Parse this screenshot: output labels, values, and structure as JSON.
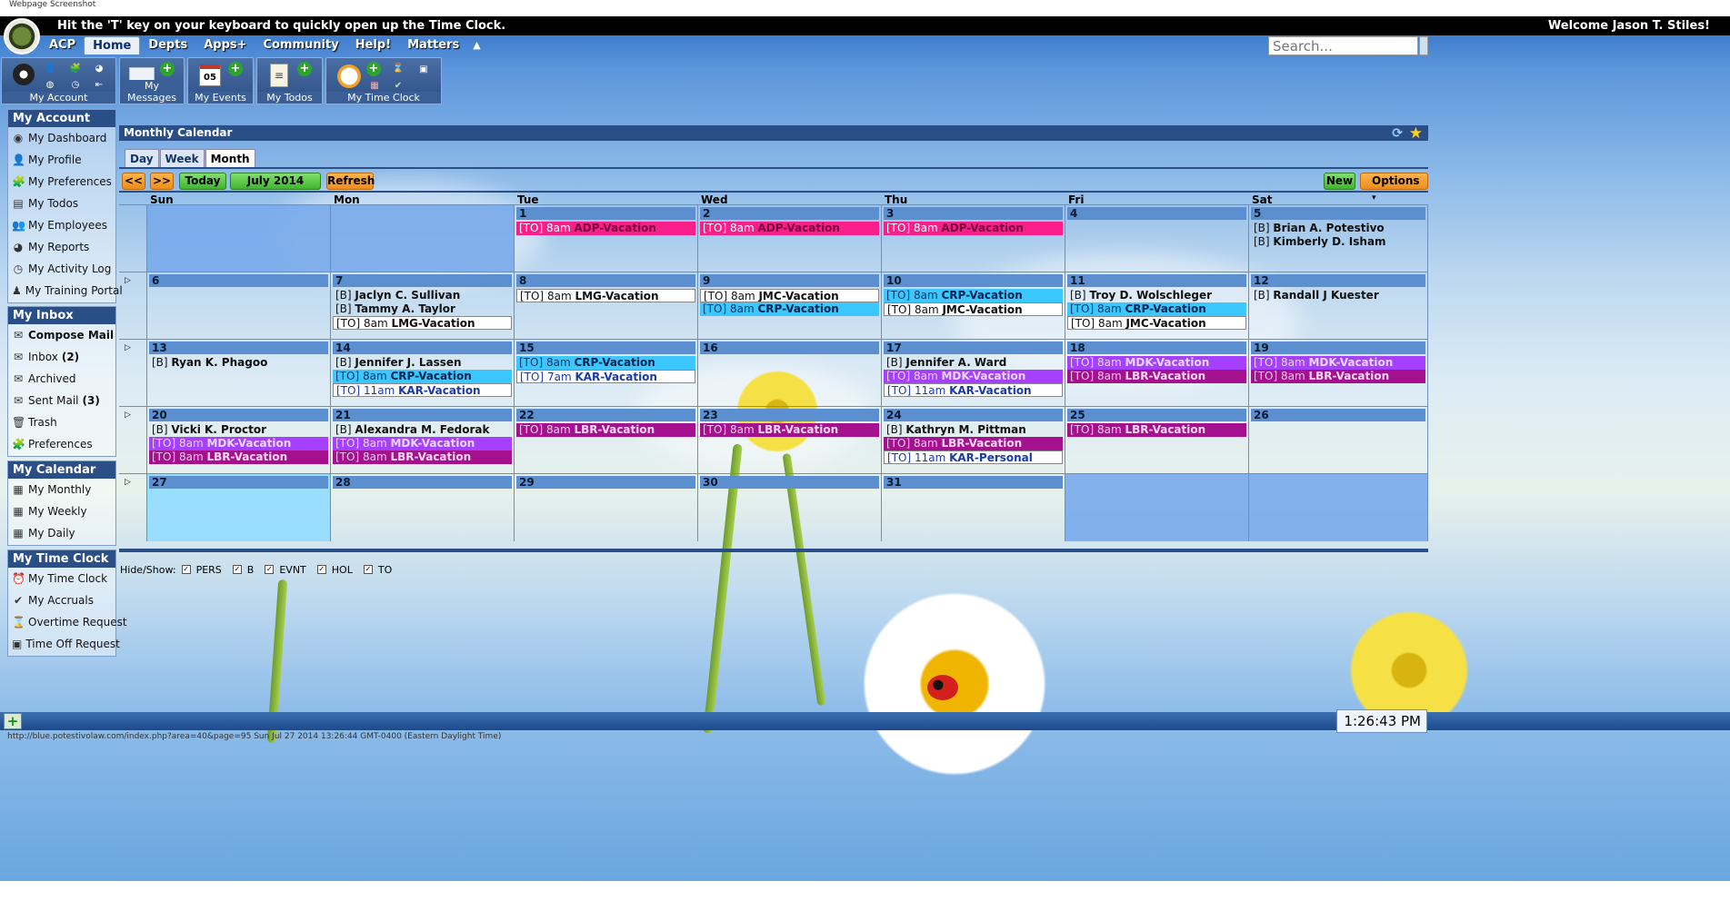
{
  "screenshot_label": "Webpage Screenshot",
  "notice": "Hit the 'T' key on your keyboard to quickly open up the Time Clock.",
  "welcome": "Welcome Jason T. Stiles!",
  "nav": [
    "ACP",
    "Home",
    "Depts",
    "Apps+",
    "Community",
    "Help!",
    "Matters"
  ],
  "nav_active": "Home",
  "search_placeholder": "Search...",
  "toolbar": {
    "my_account": "My Account",
    "my_messages": "My Messages",
    "my_events": "My Events",
    "my_todos": "My Todos",
    "my_time_clock": "My Time Clock",
    "events_day": "05"
  },
  "sidebar": {
    "account": {
      "title": "My Account",
      "items": [
        "My Dashboard",
        "My Profile",
        "My Preferences",
        "My Todos",
        "My Employees",
        "My Reports",
        "My Activity Log",
        "My Training Portal"
      ]
    },
    "inbox": {
      "title": "My Inbox",
      "items": [
        "Compose Mail",
        "Inbox",
        "Archived",
        "Sent Mail",
        "Trash",
        "Preferences"
      ],
      "inbox_count": "(2)",
      "sent_count": "(3)"
    },
    "calendar": {
      "title": "My Calendar",
      "items": [
        "My Monthly",
        "My Weekly",
        "My Daily"
      ]
    },
    "timeclock": {
      "title": "My Time Clock",
      "items": [
        "My Time Clock",
        "My Accruals",
        "Overtime Request",
        "Time Off Request"
      ]
    }
  },
  "calendar": {
    "title": "Monthly Calendar",
    "views": [
      "Day",
      "Week",
      "Month"
    ],
    "active_view": "Month",
    "buttons": {
      "prev": "<<",
      "next": ">>",
      "today": "Today",
      "month": "July 2014",
      "refresh": "Refresh",
      "new": "New",
      "options": "Options"
    },
    "weekdays": [
      "Sun",
      "Mon",
      "Tue",
      "Wed",
      "Thu",
      "Fri",
      "Sat"
    ],
    "weeks": [
      [
        {
          "day": "",
          "events": []
        },
        {
          "day": "",
          "events": []
        },
        {
          "day": "1",
          "events": [
            {
              "tag": "[TO]",
              "time": "8am",
              "name": "ADP-Vacation",
              "style": "pink"
            }
          ]
        },
        {
          "day": "2",
          "events": [
            {
              "tag": "[TO]",
              "time": "8am",
              "name": "ADP-Vacation",
              "style": "pink"
            }
          ]
        },
        {
          "day": "3",
          "events": [
            {
              "tag": "[TO]",
              "time": "8am",
              "name": "ADP-Vacation",
              "style": "pink"
            }
          ]
        },
        {
          "day": "4",
          "events": []
        },
        {
          "day": "5",
          "events": [
            {
              "tag": "[B]",
              "time": "",
              "name": "Brian A. Potestivo",
              "style": "b"
            },
            {
              "tag": "[B]",
              "time": "",
              "name": "Kimberly D. Isham",
              "style": "b"
            }
          ]
        }
      ],
      [
        {
          "day": "6",
          "events": []
        },
        {
          "day": "7",
          "events": [
            {
              "tag": "[B]",
              "time": "",
              "name": "Jaclyn C. Sullivan",
              "style": "b"
            },
            {
              "tag": "[B]",
              "time": "",
              "name": "Tammy A. Taylor",
              "style": "b"
            },
            {
              "tag": "[TO]",
              "time": "8am",
              "name": "LMG-Vacation",
              "style": "white"
            }
          ]
        },
        {
          "day": "8",
          "events": [
            {
              "tag": "[TO]",
              "time": "8am",
              "name": "LMG-Vacation",
              "style": "white"
            }
          ]
        },
        {
          "day": "9",
          "events": [
            {
              "tag": "[TO]",
              "time": "8am",
              "name": "JMC-Vacation",
              "style": "white"
            },
            {
              "tag": "[TO]",
              "time": "8am",
              "name": "CRP-Vacation",
              "style": "cyan"
            }
          ]
        },
        {
          "day": "10",
          "events": [
            {
              "tag": "[TO]",
              "time": "8am",
              "name": "CRP-Vacation",
              "style": "cyan"
            },
            {
              "tag": "[TO]",
              "time": "8am",
              "name": "JMC-Vacation",
              "style": "white"
            }
          ]
        },
        {
          "day": "11",
          "events": [
            {
              "tag": "[B]",
              "time": "",
              "name": "Troy D. Wolschleger",
              "style": "b"
            },
            {
              "tag": "[TO]",
              "time": "8am",
              "name": "CRP-Vacation",
              "style": "cyan"
            },
            {
              "tag": "[TO]",
              "time": "8am",
              "name": "JMC-Vacation",
              "style": "white"
            }
          ]
        },
        {
          "day": "12",
          "events": [
            {
              "tag": "[B]",
              "time": "",
              "name": "Randall J Kuester",
              "style": "b"
            }
          ]
        }
      ],
      [
        {
          "day": "13",
          "events": [
            {
              "tag": "[B]",
              "time": "",
              "name": "Ryan K. Phagoo",
              "style": "b"
            }
          ]
        },
        {
          "day": "14",
          "events": [
            {
              "tag": "[B]",
              "time": "",
              "name": "Jennifer J. Lassen",
              "style": "b"
            },
            {
              "tag": "[TO]",
              "time": "8am",
              "name": "CRP-Vacation",
              "style": "cyan"
            },
            {
              "tag": "[TO]",
              "time": "11am",
              "name": "KAR-Vacation",
              "style": "whiteblue"
            }
          ]
        },
        {
          "day": "15",
          "events": [
            {
              "tag": "[TO]",
              "time": "8am",
              "name": "CRP-Vacation",
              "style": "cyan"
            },
            {
              "tag": "[TO]",
              "time": "7am",
              "name": "KAR-Vacation",
              "style": "whiteblue"
            }
          ]
        },
        {
          "day": "16",
          "events": []
        },
        {
          "day": "17",
          "events": [
            {
              "tag": "[B]",
              "time": "",
              "name": "Jennifer A. Ward",
              "style": "b"
            },
            {
              "tag": "[TO]",
              "time": "8am",
              "name": "MDK-Vacation",
              "style": "purple"
            },
            {
              "tag": "[TO]",
              "time": "11am",
              "name": "KAR-Vacation",
              "style": "whiteblue"
            }
          ]
        },
        {
          "day": "18",
          "events": [
            {
              "tag": "[TO]",
              "time": "8am",
              "name": "MDK-Vacation",
              "style": "purple"
            },
            {
              "tag": "[TO]",
              "time": "8am",
              "name": "LBR-Vacation",
              "style": "magenta"
            }
          ]
        },
        {
          "day": "19",
          "events": [
            {
              "tag": "[TO]",
              "time": "8am",
              "name": "MDK-Vacation",
              "style": "purple"
            },
            {
              "tag": "[TO]",
              "time": "8am",
              "name": "LBR-Vacation",
              "style": "magenta"
            }
          ]
        }
      ],
      [
        {
          "day": "20",
          "events": [
            {
              "tag": "[B]",
              "time": "",
              "name": "Vicki K. Proctor",
              "style": "b"
            },
            {
              "tag": "[TO]",
              "time": "8am",
              "name": "MDK-Vacation",
              "style": "purple"
            },
            {
              "tag": "[TO]",
              "time": "8am",
              "name": "LBR-Vacation",
              "style": "magenta"
            }
          ]
        },
        {
          "day": "21",
          "events": [
            {
              "tag": "[B]",
              "time": "",
              "name": "Alexandra M. Fedorak",
              "style": "b"
            },
            {
              "tag": "[TO]",
              "time": "8am",
              "name": "MDK-Vacation",
              "style": "purple"
            },
            {
              "tag": "[TO]",
              "time": "8am",
              "name": "LBR-Vacation",
              "style": "magenta"
            }
          ]
        },
        {
          "day": "22",
          "events": [
            {
              "tag": "[TO]",
              "time": "8am",
              "name": "LBR-Vacation",
              "style": "magenta"
            }
          ]
        },
        {
          "day": "23",
          "events": [
            {
              "tag": "[TO]",
              "time": "8am",
              "name": "LBR-Vacation",
              "style": "magenta"
            }
          ]
        },
        {
          "day": "24",
          "events": [
            {
              "tag": "[B]",
              "time": "",
              "name": "Kathryn M. Pittman",
              "style": "b"
            },
            {
              "tag": "[TO]",
              "time": "8am",
              "name": "LBR-Vacation",
              "style": "magenta"
            },
            {
              "tag": "[TO]",
              "time": "11am",
              "name": "KAR-Personal",
              "style": "whiteblue"
            }
          ]
        },
        {
          "day": "25",
          "events": [
            {
              "tag": "[TO]",
              "time": "8am",
              "name": "LBR-Vacation",
              "style": "magenta"
            }
          ]
        },
        {
          "day": "26",
          "events": []
        }
      ],
      [
        {
          "day": "27",
          "events": [],
          "today": true
        },
        {
          "day": "28",
          "events": []
        },
        {
          "day": "29",
          "events": []
        },
        {
          "day": "30",
          "events": []
        },
        {
          "day": "31",
          "events": []
        },
        {
          "day": "",
          "events": []
        },
        {
          "day": "",
          "events": []
        }
      ]
    ],
    "hide_show": {
      "label": "Hide/Show:",
      "filters": [
        "PERS",
        "B",
        "EVNT",
        "HOL",
        "TO"
      ]
    }
  },
  "clock": "1:26:43 PM",
  "status_url": "http://blue.potestivolaw.com/index.php?area=40&page=95 Sun Jul 27 2014 13:26:44 GMT-0400 (Eastern Daylight Time)"
}
